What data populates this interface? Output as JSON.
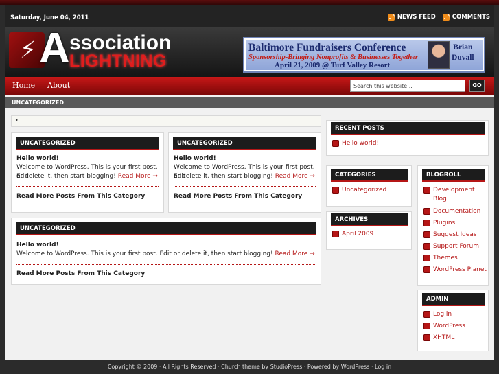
{
  "topbar": {
    "date": "Saturday, June 04, 2011",
    "news_feed": "NEWS FEED",
    "comments": "COMMENTS"
  },
  "logo": {
    "letter_a": "A",
    "line1": "ssociation",
    "line2": "LIGHTNING"
  },
  "banner": {
    "title": "Baltimore Fundraisers Conference",
    "subtitle": "Sponsorship-Bringing Nonprofits & Businesses Together",
    "date": "April 21, 2009 @ Turf Valley Resort",
    "name_first": "Brian",
    "name_last": "Duvall"
  },
  "nav": {
    "home": "Home",
    "about": "About",
    "search_placeholder": "Search this website...",
    "go": "GO"
  },
  "breadcrumb": "UNCATEGORIZED",
  "notice": "•",
  "posts": [
    {
      "category": "UNCATEGORIZED",
      "title": "Hello world!",
      "excerpt_1": "Welcome to WordPress. This is your first post. Edit",
      "excerpt_2": "or delete it, then start blogging!",
      "read_more": "Read More →",
      "more_posts": "Read More Posts From This Category"
    },
    {
      "category": "UNCATEGORIZED",
      "title": "Hello world!",
      "excerpt_1": "Welcome to WordPress. This is your first post. Edit",
      "excerpt_2": "or delete it, then start blogging!",
      "read_more": "Read More →",
      "more_posts": "Read More Posts From This Category"
    },
    {
      "category": "UNCATEGORIZED",
      "title": "Hello world!",
      "excerpt_1": "Welcome to WordPress. This is your first post. Edit or delete it, then start blogging!",
      "read_more": "Read More →",
      "more_posts": "Read More Posts From This Category"
    }
  ],
  "sidebar": {
    "recent_title": "RECENT POSTS",
    "recent": [
      "Hello world!"
    ],
    "categories_title": "CATEGORIES",
    "categories": [
      "Uncategorized"
    ],
    "archives_title": "ARCHIVES",
    "archives": [
      "April 2009"
    ],
    "blogroll_title": "BLOGROLL",
    "blogroll": [
      "Development Blog",
      "Documentation",
      "Plugins",
      "Suggest Ideas",
      "Support Forum",
      "Themes",
      "WordPress Planet"
    ],
    "admin_title": "ADMIN",
    "admin": [
      "Log in",
      "WordPress",
      "XHTML"
    ]
  },
  "footer": "Copyright © 2009 · All Rights Reserved · Church theme by StudioPress · Powered by WordPress · Log in"
}
